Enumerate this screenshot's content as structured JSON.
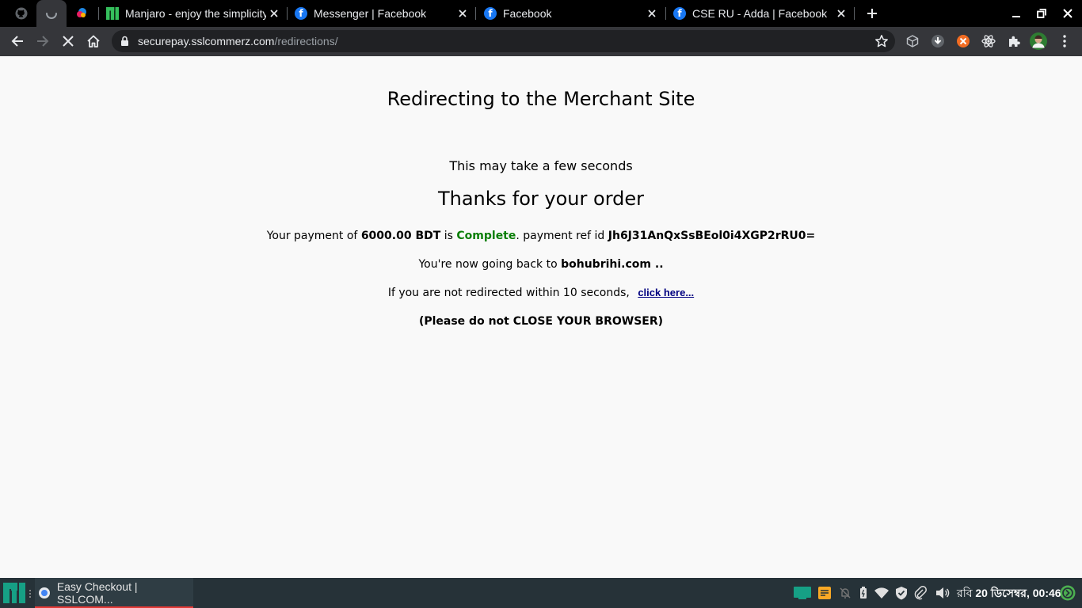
{
  "browser": {
    "tabs": [
      {
        "title": "Manjaro - enjoy the simplicity",
        "favicon": "manjaro-icon"
      },
      {
        "title": "Messenger | Facebook",
        "favicon": "facebook-icon"
      },
      {
        "title": "Facebook",
        "favicon": "facebook-icon"
      },
      {
        "title": "CSE RU - Adda | Facebook",
        "favicon": "facebook-icon"
      }
    ],
    "pinned_tabs": [
      "github-icon",
      "loading-spinner-icon",
      "figma-icon"
    ],
    "url_domain": "securepay.sslcommerz.com",
    "url_path": "/redirections/"
  },
  "page": {
    "heading": "Redirecting to the Merchant Site",
    "subheading": "This may take a few seconds",
    "thanks": "Thanks for your order",
    "payment_prefix": "Your payment of",
    "amount": "6000.00 BDT",
    "is_text": "is",
    "status": "Complete",
    "ref_prefix": ". payment ref id",
    "ref_id": "Jh6J31AnQxSsBEol0i4XGP2rRU0=",
    "goback_prefix": "You're now going back to",
    "merchant_site": "bohubrihi.com ..",
    "not_redirected_text": "If you are not redirected within 10 seconds,",
    "click_here": "click here...",
    "warning": "(Please do not CLOSE YOUR BROWSER)"
  },
  "taskbar": {
    "task_label": "Easy Checkout | SSLCOM...",
    "clock_day": "রবি",
    "clock_date": "20 ডিসেম্বর, 00:46"
  },
  "colors": {
    "status_complete": "#0a7e07",
    "link": "#000080",
    "taskbar_accent": "#e53935"
  }
}
